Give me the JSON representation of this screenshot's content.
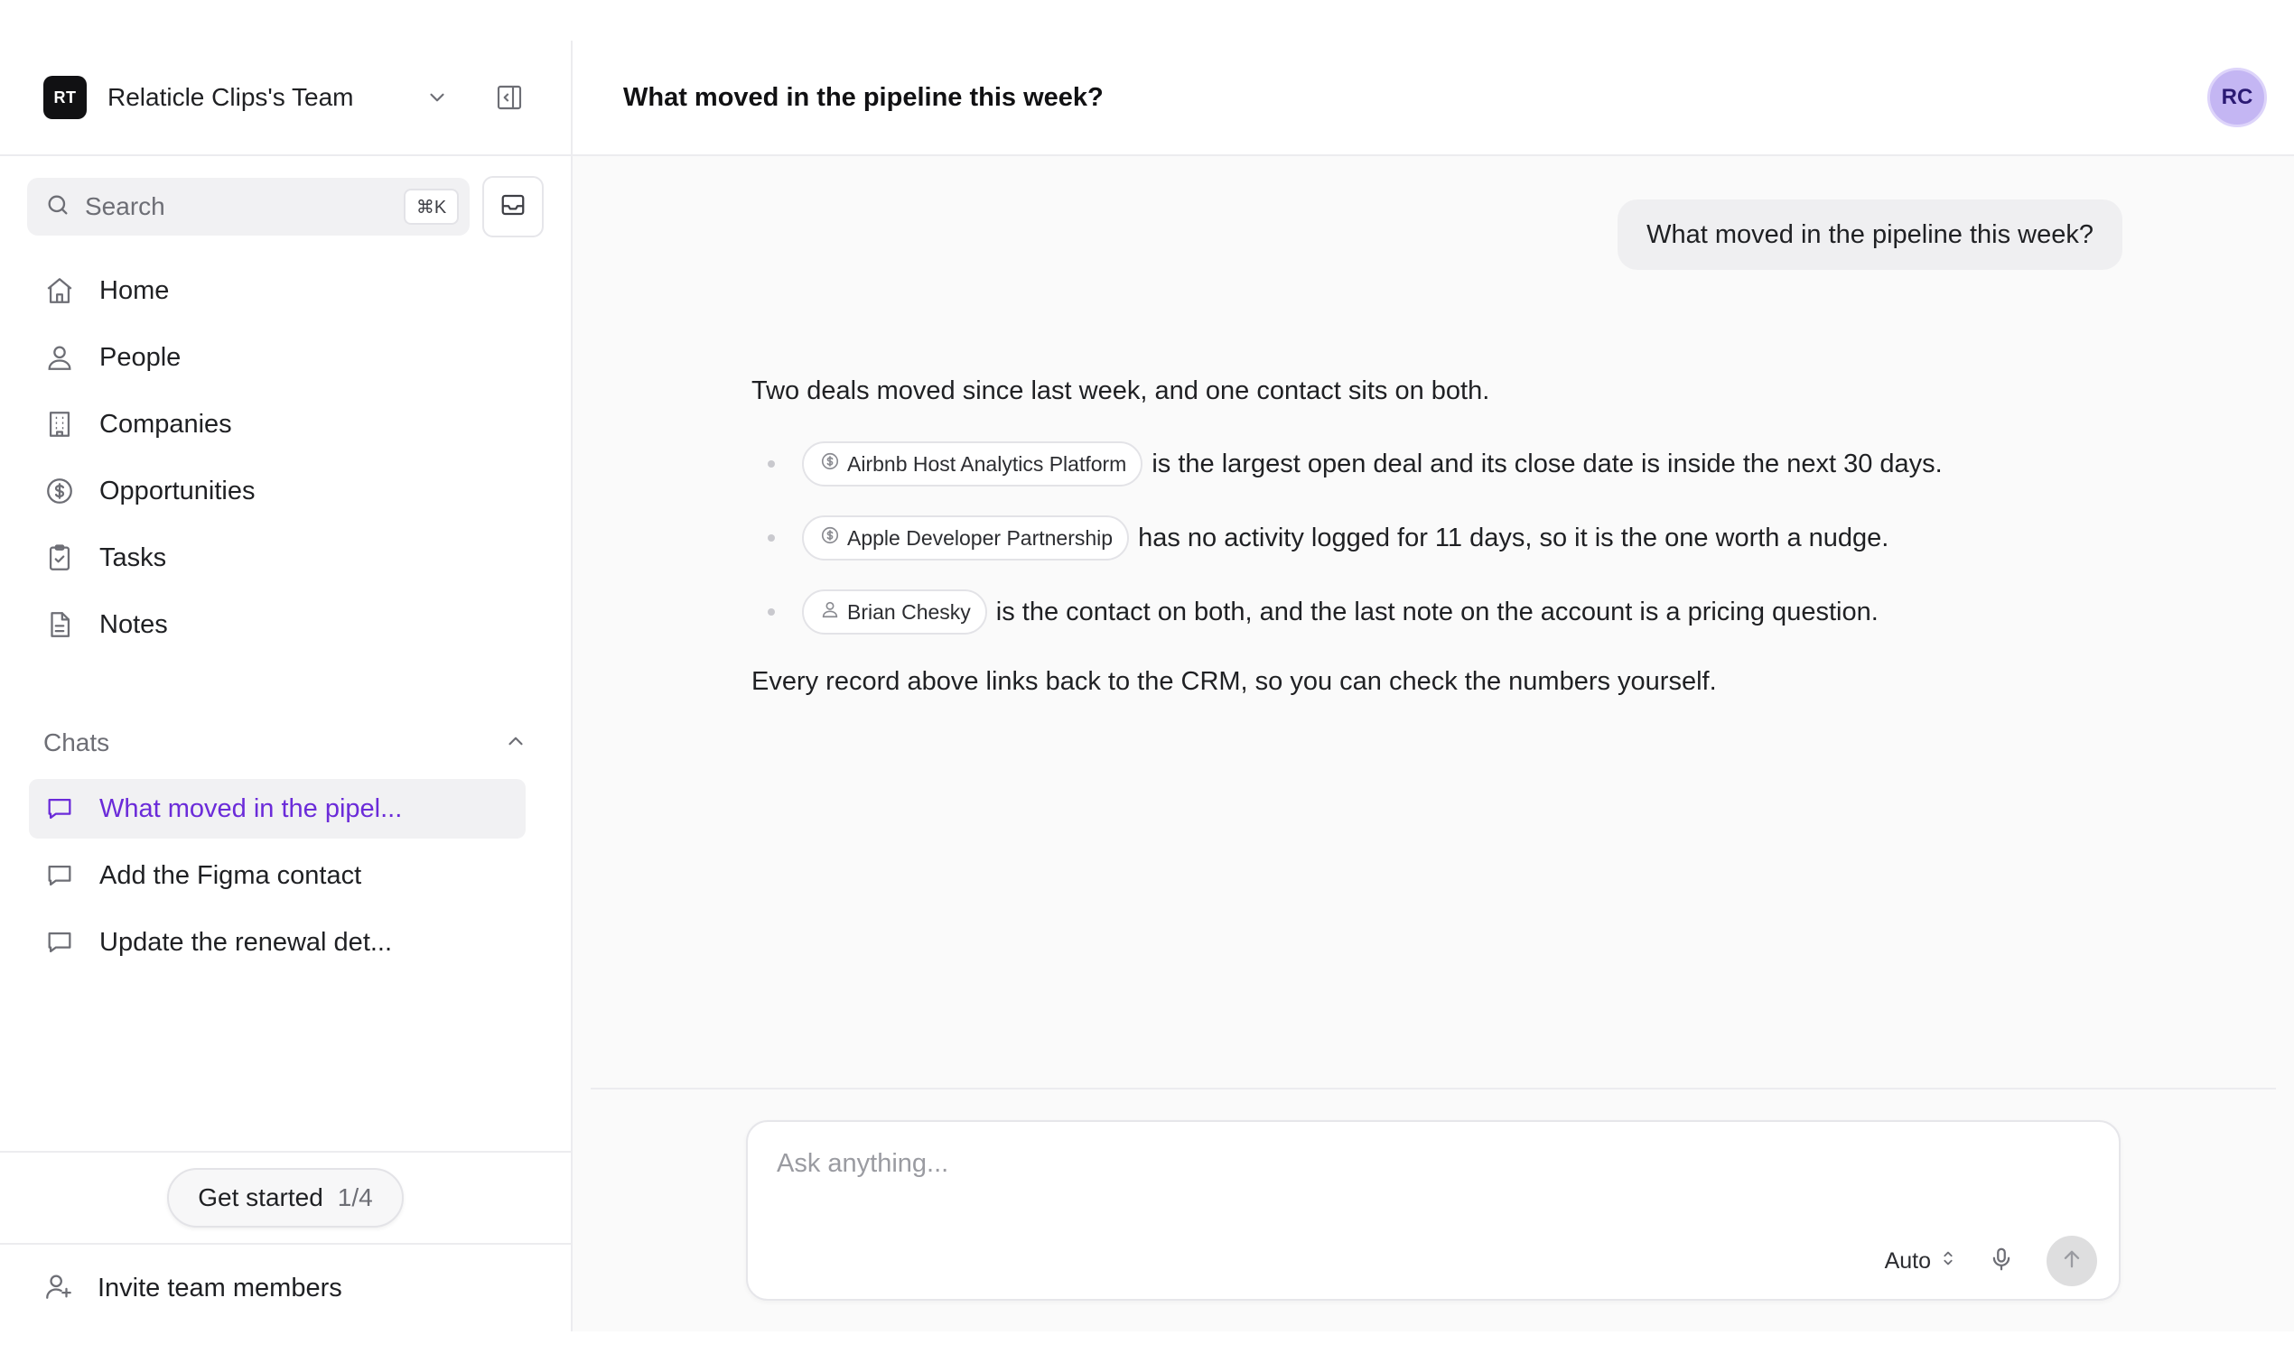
{
  "sidebar": {
    "team": {
      "logo": "RT",
      "name": "Relaticle Clips's Team"
    },
    "search": {
      "label": "Search",
      "shortcut": "⌘K"
    },
    "nav": [
      {
        "label": "Home",
        "icon": "home-icon"
      },
      {
        "label": "People",
        "icon": "user-icon"
      },
      {
        "label": "Companies",
        "icon": "building-icon"
      },
      {
        "label": "Opportunities",
        "icon": "dollar-circle-icon"
      },
      {
        "label": "Tasks",
        "icon": "clipboard-check-icon"
      },
      {
        "label": "Notes",
        "icon": "document-icon"
      }
    ],
    "chats": {
      "heading": "Chats",
      "items": [
        {
          "label": "What moved in the pipel...",
          "active": true
        },
        {
          "label": "Add the Figma contact",
          "active": false
        },
        {
          "label": "Update the renewal det...",
          "active": false
        }
      ]
    },
    "get_started": {
      "label": "Get started",
      "progress": "1/4"
    },
    "invite": {
      "label": "Invite team members"
    }
  },
  "header": {
    "title": "What moved in the pipeline this week?",
    "avatar": "RC"
  },
  "conversation": {
    "user_message": "What moved in the pipeline this week?",
    "assistant": {
      "intro": "Two deals moved since last week, and one contact sits on both.",
      "bullets": [
        {
          "chip": "Airbnb Host Analytics Platform",
          "chip_icon": "dollar-circle-icon",
          "text": "is the largest open deal and its close date is inside the next 30 days."
        },
        {
          "chip": "Apple Developer Partnership",
          "chip_icon": "dollar-circle-icon",
          "text": "has no activity logged for 11 days, so it is the one worth a nudge."
        },
        {
          "chip": "Brian Chesky",
          "chip_icon": "user-icon",
          "text": "is the contact on both, and the last note on the account is a pricing question."
        }
      ],
      "outro": "Every record above links back to the CRM, so you can check the numbers yourself."
    }
  },
  "composer": {
    "placeholder": "Ask anything...",
    "mode": "Auto"
  },
  "colors": {
    "accent": "#6b2bd9",
    "avatar_bg": "#c4b6f3"
  }
}
